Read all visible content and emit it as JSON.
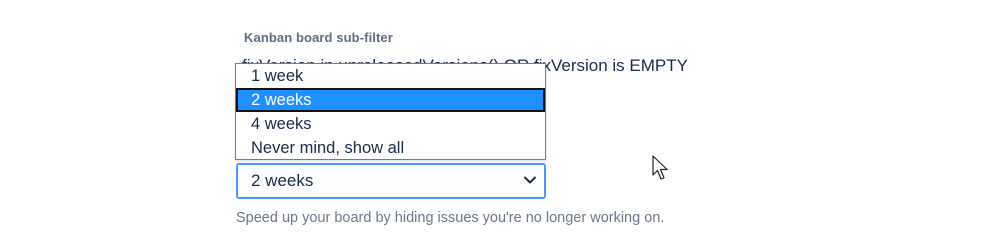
{
  "subfilter": {
    "label": "Kanban board sub-filter",
    "jql": "fixVersion in unreleasedVersions() OR fixVersion is EMPTY"
  },
  "hide_issues": {
    "options": [
      "1 week",
      "2 weeks",
      "4 weeks",
      "Never mind, show all"
    ],
    "highlighted_option": "2 weeks",
    "selected_value": "2 weeks",
    "help_text": "Speed up your board by hiding issues you're no longer working on."
  },
  "icons": {
    "select_chevron": "chevron-down-icon",
    "pointer": "mouse-cursor-icon"
  },
  "colors": {
    "highlight": "#1e90ff",
    "focus_border": "#4c9aff",
    "label": "#5e6c84",
    "help_text": "#6b778c"
  }
}
